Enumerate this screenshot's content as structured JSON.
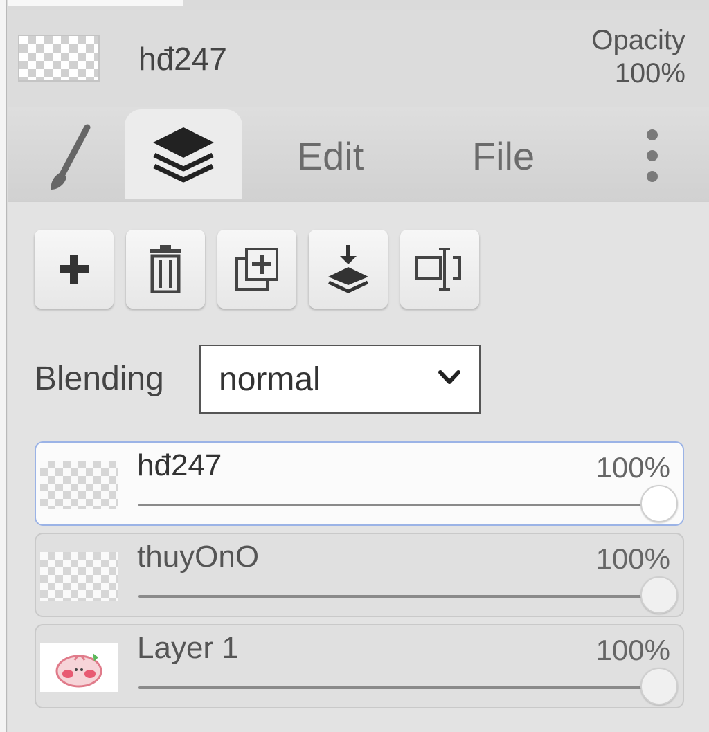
{
  "current_layer": {
    "name": "hđ247",
    "opacity_label": "Opacity",
    "opacity_value": "100%"
  },
  "tabs": [
    {
      "id": "brush",
      "icon": "brush-icon"
    },
    {
      "id": "layers",
      "icon": "layers-icon",
      "active": true
    },
    {
      "id": "edit",
      "label": "Edit"
    },
    {
      "id": "file",
      "label": "File"
    },
    {
      "id": "more",
      "icon": "more-vertical-icon"
    }
  ],
  "toolbar": [
    {
      "name": "add-layer-button",
      "icon": "plus-icon"
    },
    {
      "name": "delete-layer-button",
      "icon": "trash-icon"
    },
    {
      "name": "duplicate-layer-button",
      "icon": "duplicate-icon"
    },
    {
      "name": "merge-down-button",
      "icon": "merge-down-icon"
    },
    {
      "name": "rename-layer-button",
      "icon": "rename-icon"
    }
  ],
  "blending": {
    "label": "Blending",
    "value": "normal"
  },
  "layers": [
    {
      "name": "hđ247",
      "opacity_text": "100%",
      "opacity": 1.0,
      "selected": true,
      "thumb": "transparent"
    },
    {
      "name": "thuyOnO",
      "opacity_text": "100%",
      "opacity": 1.0,
      "selected": false,
      "thumb": "transparent"
    },
    {
      "name": "Layer 1",
      "opacity_text": "100%",
      "opacity": 1.0,
      "selected": false,
      "thumb": "artwork"
    }
  ],
  "colors": {
    "selection_border": "#9bb3e6",
    "panel_bg": "#dcdcdc"
  }
}
